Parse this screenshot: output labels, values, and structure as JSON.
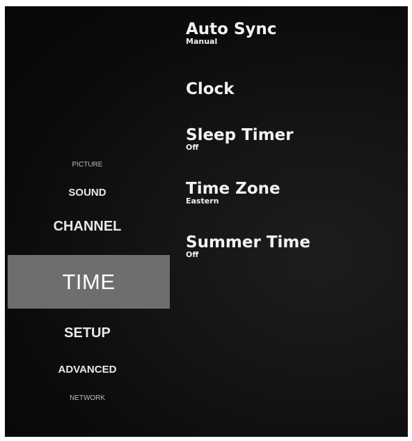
{
  "menu": {
    "categories": [
      {
        "label": "PICTURE"
      },
      {
        "label": "SOUND"
      },
      {
        "label": "CHANNEL"
      },
      {
        "label": "TIME",
        "selected": true
      },
      {
        "label": "SETUP"
      },
      {
        "label": "ADVANCED"
      },
      {
        "label": "NETWORK"
      }
    ]
  },
  "settings": {
    "items": [
      {
        "label": "Auto Sync",
        "value": "Manual"
      },
      {
        "label": "Clock",
        "value": ""
      },
      {
        "label": "Sleep Timer",
        "value": "Off"
      },
      {
        "label": "Time Zone",
        "value": "Eastern"
      },
      {
        "label": "Summer Time",
        "value": "Off"
      }
    ]
  },
  "colors": {
    "background": "#0b0b0b",
    "selected_highlight": "#6e6e6e",
    "text": "#f2f2f2"
  }
}
